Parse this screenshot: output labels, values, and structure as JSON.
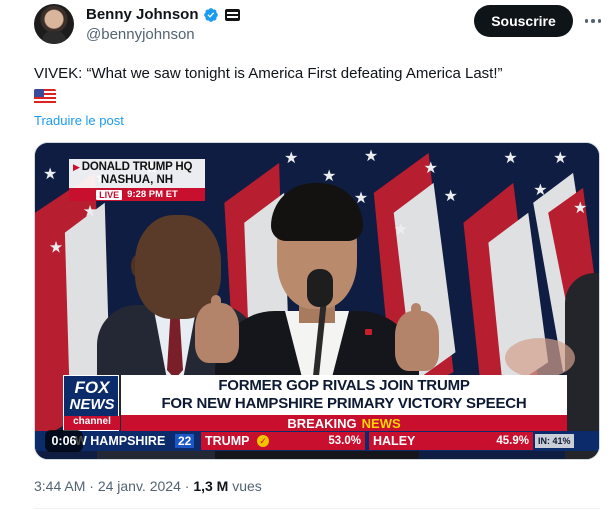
{
  "author": {
    "name": "Benny Johnson",
    "handle": "@bennyjohnson"
  },
  "header": {
    "subscribe_label": "Souscrire"
  },
  "tweet": {
    "text": "VIVEK: “What we saw tonight is America First defeating America Last!”",
    "translate_label": "Traduire le post"
  },
  "video": {
    "timer": "0:06",
    "location": {
      "line1": "DONALD TRUMP HQ",
      "line2": "NASHUA, NH",
      "live_label": "LIVE",
      "time": "9:28 PM ET"
    },
    "network": {
      "fox": "FOX",
      "news": "NEWS",
      "channel": "channel"
    },
    "headline_line1": "FORMER GOP RIVALS JOIN TRUMP",
    "headline_line2": "FOR NEW HAMPSHIRE PRIMARY VICTORY SPEECH",
    "breaking": {
      "word1": "BREAKING",
      "word2": "NEWS"
    },
    "ticker": {
      "state": "W HAMPSHIRE",
      "number": "22",
      "candidate1": {
        "name": "TRUMP",
        "pct": "53.0%"
      },
      "candidate2": {
        "name": "HALEY",
        "pct": "45.9%"
      },
      "reporting": "IN: 41%"
    }
  },
  "footer": {
    "time": "3:44 AM",
    "separator": "·",
    "date": "24 janv. 2024",
    "views_count": "1,3 M",
    "views_label": "vues"
  },
  "colors": {
    "accent_blue": "#1d9bf0",
    "fox_red": "#c8102e",
    "fox_navy": "#0b2b6b"
  }
}
